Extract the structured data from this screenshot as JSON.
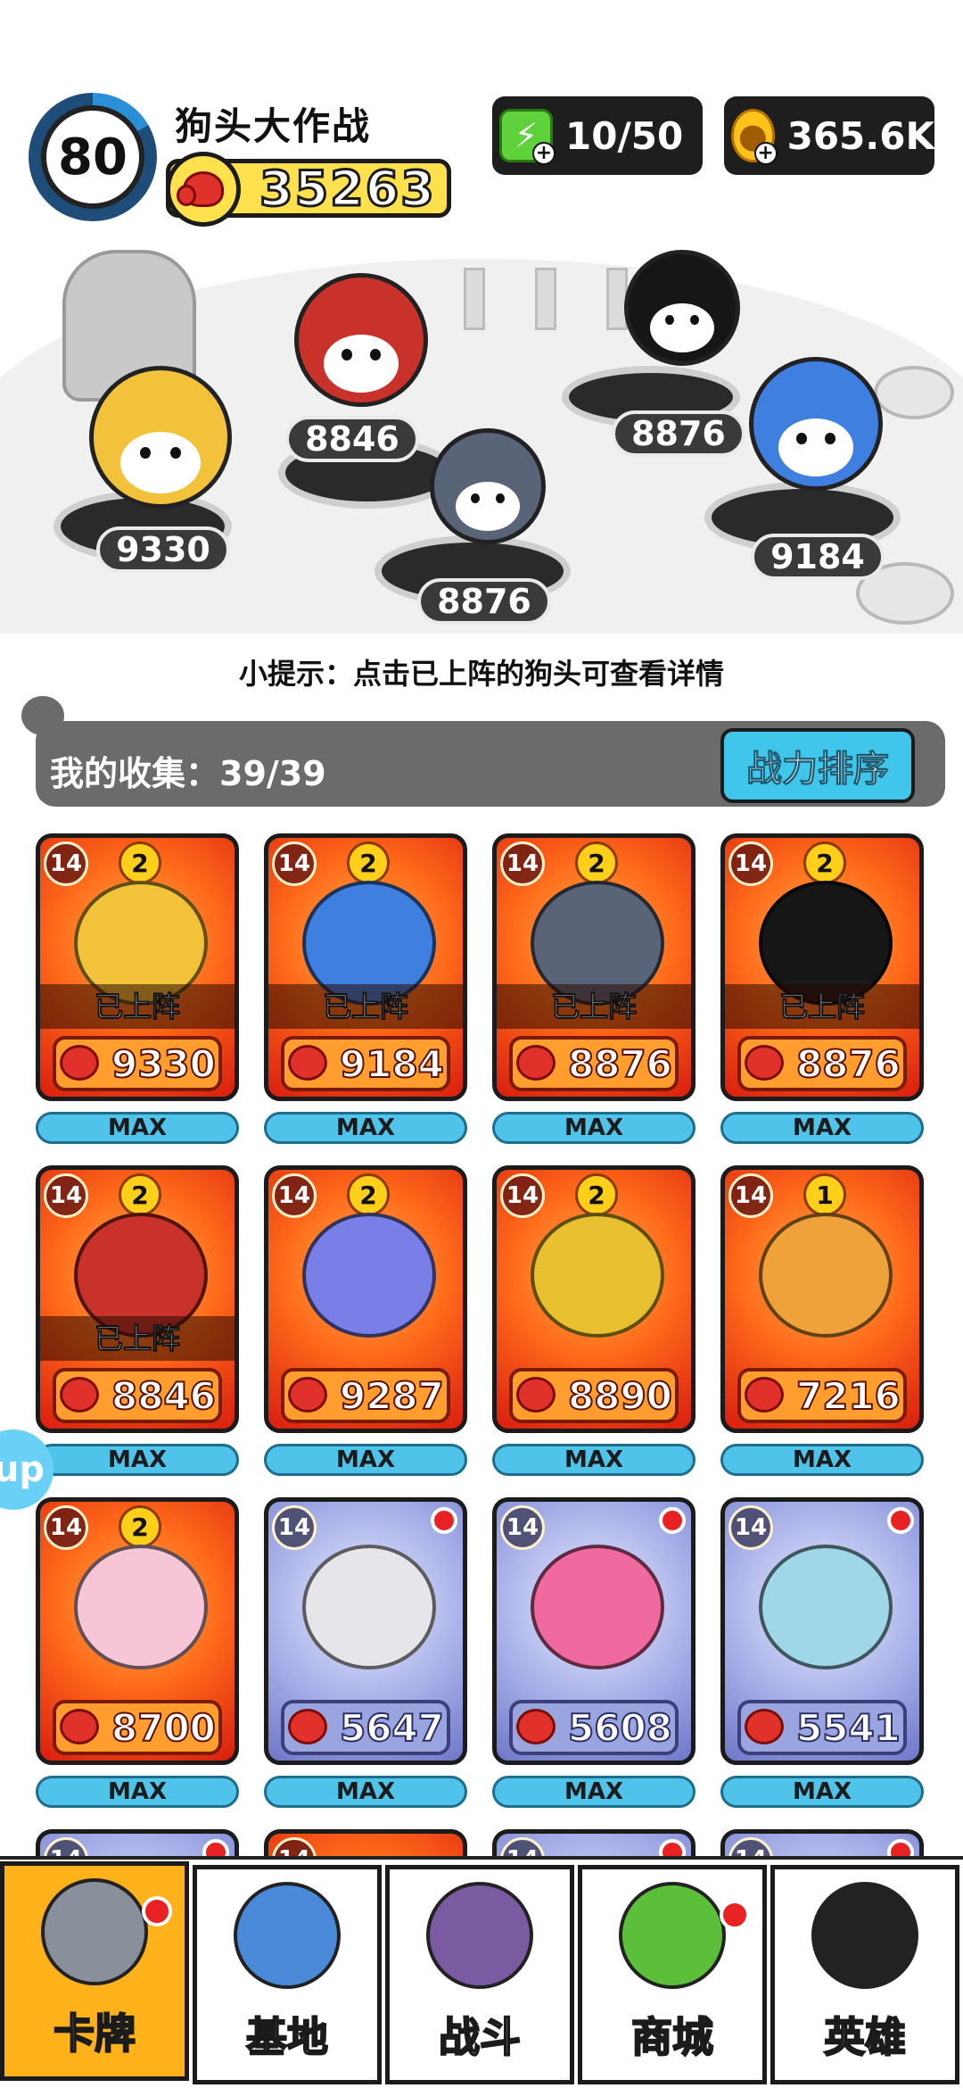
{
  "header": {
    "level": "80",
    "title": "狗头大作战",
    "power": "35263",
    "energy": "10/50",
    "coins": "365.6K",
    "icons": {
      "energy": "lightning-icon",
      "coins": "coin-icon",
      "power": "boxing-glove-icon"
    }
  },
  "battlefield": {
    "heroes": [
      {
        "name": "golden-helmet-dog",
        "power": "9330",
        "color": "#f2c23a"
      },
      {
        "name": "soldier-dog",
        "power": "8846",
        "color": "#c8322a"
      },
      {
        "name": "husky-dog",
        "power": "8876",
        "color": "#5a6478"
      },
      {
        "name": "bomb-dog",
        "power": "8876",
        "color": "#161616"
      },
      {
        "name": "fire-ice-dog",
        "power": "9184",
        "color": "#3f7fe0"
      }
    ]
  },
  "hint": "小提示：点击已上阵的狗头可查看详情",
  "collection": {
    "label": "我的收集：39/39",
    "sort_button": "战力排序"
  },
  "cards": [
    {
      "level": "14",
      "stars": "2",
      "power": "9330",
      "deployed": "已上阵",
      "max": "MAX",
      "rarity": "gold",
      "tint": "#f2c23a"
    },
    {
      "level": "14",
      "stars": "2",
      "power": "9184",
      "deployed": "已上阵",
      "max": "MAX",
      "rarity": "gold",
      "tint": "#3f7fe0"
    },
    {
      "level": "14",
      "stars": "2",
      "power": "8876",
      "deployed": "已上阵",
      "max": "MAX",
      "rarity": "gold",
      "tint": "#5a6478"
    },
    {
      "level": "14",
      "stars": "2",
      "power": "8876",
      "deployed": "已上阵",
      "max": "MAX",
      "rarity": "gold",
      "tint": "#161616"
    },
    {
      "level": "14",
      "stars": "2",
      "power": "8846",
      "deployed": "已上阵",
      "max": "MAX",
      "rarity": "gold",
      "tint": "#c8322a"
    },
    {
      "level": "14",
      "stars": "2",
      "power": "9287",
      "deployed": "",
      "max": "MAX",
      "rarity": "gold",
      "tint": "#7a7fe8"
    },
    {
      "level": "14",
      "stars": "2",
      "power": "8890",
      "deployed": "",
      "max": "MAX",
      "rarity": "gold",
      "tint": "#e9c030"
    },
    {
      "level": "14",
      "stars": "1",
      "power": "7216",
      "deployed": "",
      "max": "MAX",
      "rarity": "gold",
      "tint": "#f0a23a"
    },
    {
      "level": "14",
      "stars": "2",
      "power": "8700",
      "deployed": "",
      "max": "MAX",
      "rarity": "gold",
      "tint": "#f6c6d6"
    },
    {
      "level": "14",
      "stars": "",
      "power": "5647",
      "deployed": "",
      "max": "MAX",
      "rarity": "blue",
      "tint": "#e6e6ea"
    },
    {
      "level": "14",
      "stars": "",
      "power": "5608",
      "deployed": "",
      "max": "MAX",
      "rarity": "blue",
      "tint": "#f06aa0"
    },
    {
      "level": "14",
      "stars": "",
      "power": "5541",
      "deployed": "",
      "max": "MAX",
      "rarity": "blue",
      "tint": "#9fd7e8"
    },
    {
      "level": "14",
      "stars": "",
      "power": "",
      "deployed": "",
      "max": "",
      "rarity": "blue",
      "tint": "#c7c7ea"
    },
    {
      "level": "14",
      "stars": "",
      "power": "",
      "deployed": "",
      "max": "",
      "rarity": "gold",
      "tint": "#ff8a3a"
    },
    {
      "level": "14",
      "stars": "",
      "power": "",
      "deployed": "",
      "max": "",
      "rarity": "blue",
      "tint": "#c7c7ea"
    },
    {
      "level": "14",
      "stars": "",
      "power": "",
      "deployed": "",
      "max": "",
      "rarity": "blue",
      "tint": "#c7c7ea"
    }
  ],
  "side_bubble": "up",
  "nav": [
    {
      "label": "卡牌",
      "icon": "dog-face-icon",
      "active": true,
      "badge": true,
      "color": "#8a8f9c"
    },
    {
      "label": "基地",
      "icon": "castle-icon",
      "active": false,
      "badge": false,
      "color": "#4a88d8"
    },
    {
      "label": "战斗",
      "icon": "paw-icon",
      "active": false,
      "badge": false,
      "color": "#7a5aa0"
    },
    {
      "label": "商城",
      "icon": "cash-icon",
      "active": false,
      "badge": true,
      "color": "#5bbf3a"
    },
    {
      "label": "英雄",
      "icon": "top-hat-dog-icon",
      "active": false,
      "badge": false,
      "color": "#222222"
    }
  ]
}
